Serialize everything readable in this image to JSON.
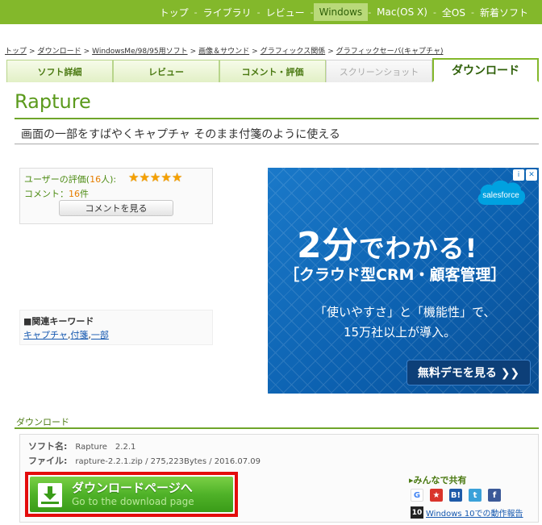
{
  "topnav": {
    "items": [
      {
        "label": "トップ"
      },
      {
        "label": "ライブラリ"
      },
      {
        "label": "レビュー"
      },
      {
        "label": "Windows"
      },
      {
        "label": "Mac(OS X)"
      },
      {
        "label": "全OS"
      },
      {
        "label": "新着ソフト"
      }
    ],
    "separator": "-"
  },
  "breadcrumb": {
    "items": [
      "トップ",
      "ダウンロード",
      "WindowsMe/98/95用ソフト",
      "画像＆サウンド",
      "グラフィックス関係",
      "グラフィックセーバ(キャプチャ)"
    ],
    "separator": ">"
  },
  "tabs": [
    {
      "label": "ソフト詳細"
    },
    {
      "label": "レビュー"
    },
    {
      "label": "コメント・評価"
    },
    {
      "label": "スクリーンショット"
    },
    {
      "label": "ダウンロード"
    }
  ],
  "software": {
    "title": "Rapture",
    "tagline": "画面の一部をすばやくキャプチャ そのまま付箋のように使える"
  },
  "rating": {
    "label_prefix": "ユーザーの評価(",
    "count": "16",
    "label_suffix": "人):",
    "stars": 5,
    "comment_prefix": "コメント：",
    "comment_count": "16",
    "comment_suffix": "件",
    "comment_button": "コメントを見る"
  },
  "keywords": {
    "title": "■関連キーワード",
    "items": [
      "キャプチャ",
      "付箋",
      "一部"
    ],
    "separator": ","
  },
  "ad": {
    "brand": "salesforce",
    "headline_big": "2分",
    "headline_small": "でわかる!",
    "subhead": "［クラウド型CRM・顧客管理］",
    "line1": "「使いやすさ」と「機能性」で、",
    "line2": "15万社以上が導入。",
    "cta": "無料デモを見る ❯❯",
    "info_icon": "i",
    "close_icon": "✕",
    "colors": {
      "bg": "#0b5fae",
      "cta": "#0d3f78"
    }
  },
  "download": {
    "heading": "ダウンロード",
    "soft_label": "ソフト名:",
    "soft_value": "Rapture　2.2.1",
    "file_label": "ファイル:",
    "file_value": "rapture-2.2.1.zip / 275,223Bytes / 2016.07.09",
    "button_label": "ダウンロードページへ",
    "button_sub": "Go to the download page",
    "share_title": "みんなで共有",
    "share_icons": [
      {
        "name": "google-icon",
        "glyph": "G",
        "color": "#ffffff"
      },
      {
        "name": "star-bookmark-icon",
        "glyph": "★",
        "color": "#d9342b"
      },
      {
        "name": "hatena-icon",
        "glyph": "B!",
        "color": "#1e5aa8"
      },
      {
        "name": "twitter-icon",
        "glyph": "t",
        "color": "#3aa1d9"
      },
      {
        "name": "facebook-icon",
        "glyph": "f",
        "color": "#3b5998"
      }
    ],
    "win10_badge": "10",
    "win10_link": "Windows 10での動作報告"
  }
}
